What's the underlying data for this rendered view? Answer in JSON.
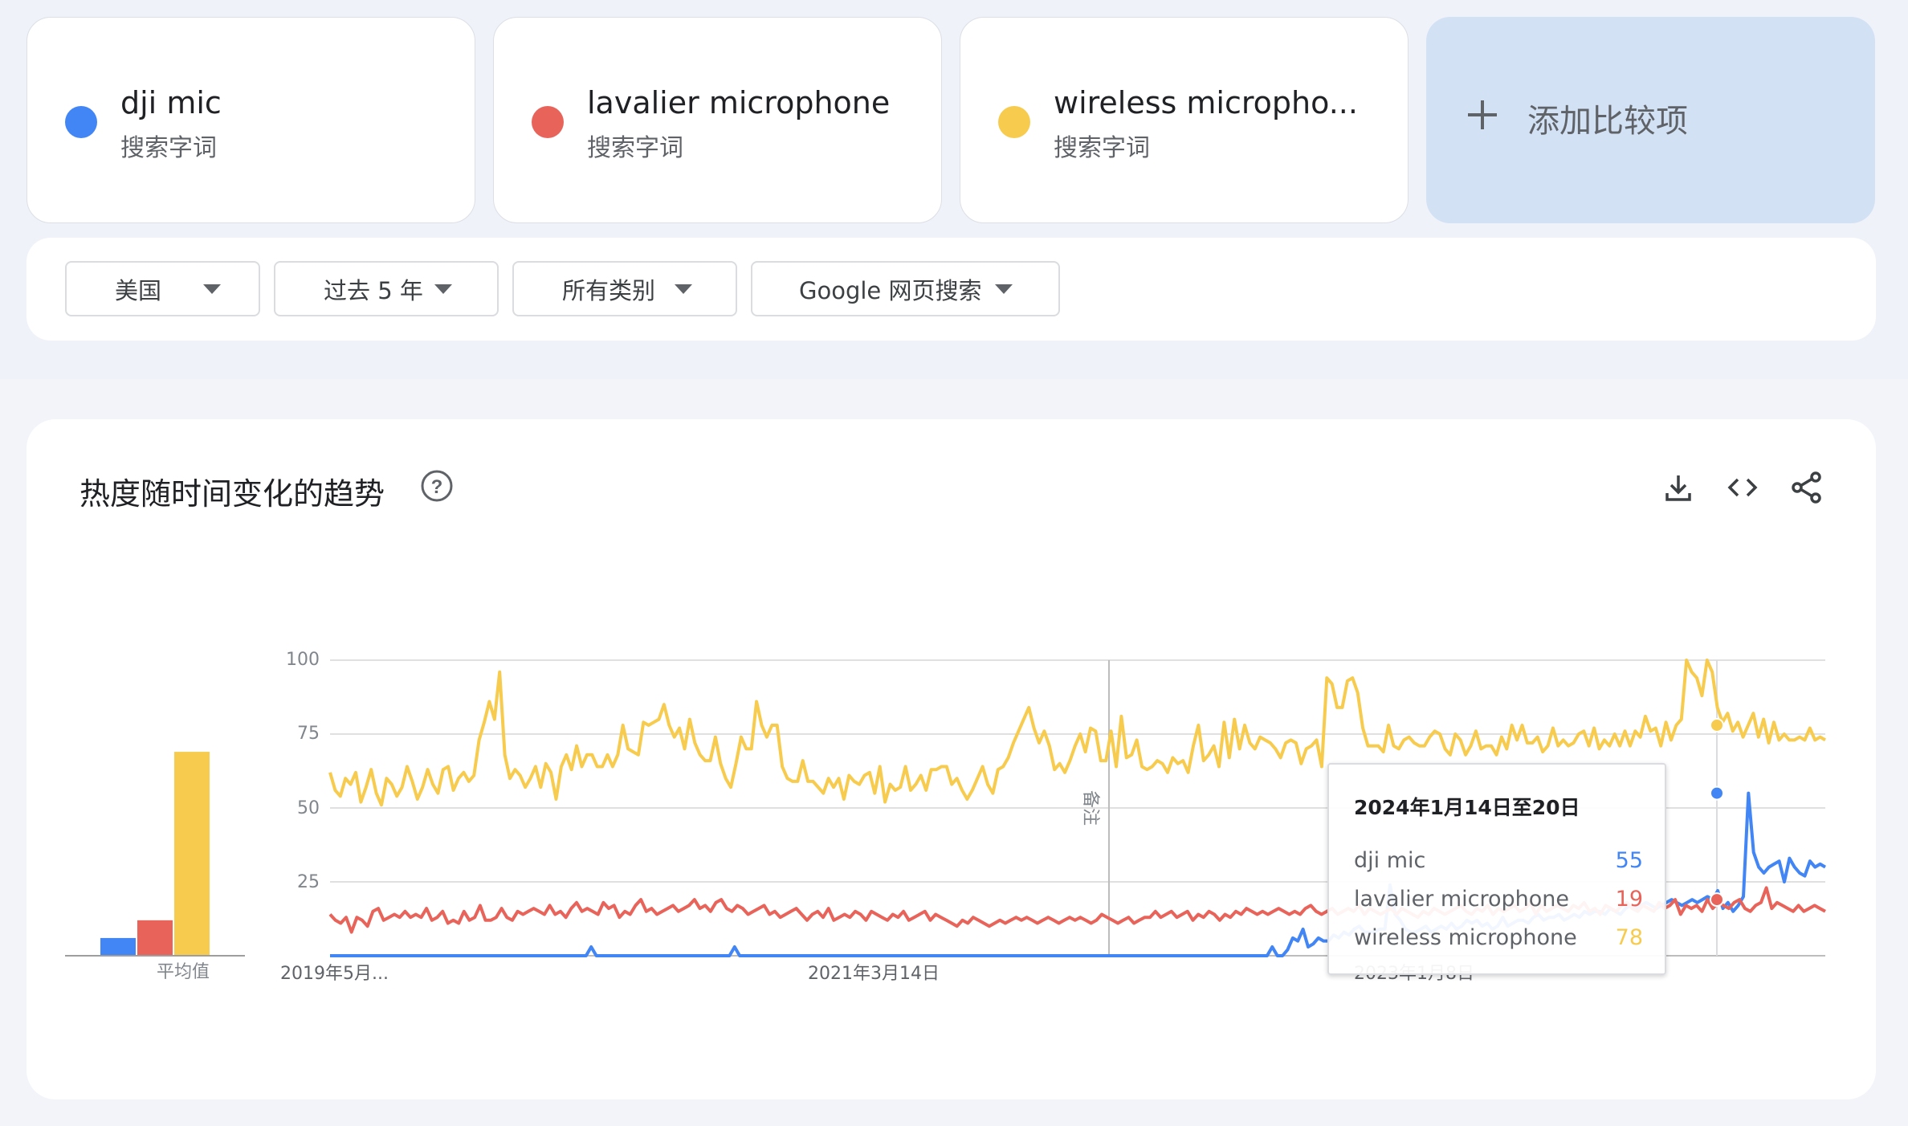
{
  "terms": [
    {
      "name": "dji mic",
      "type": "搜索字词",
      "color": "#4285f4"
    },
    {
      "name": "lavalier microphone",
      "type": "搜索字词",
      "color": "#e8645a"
    },
    {
      "name": "wireless micropho...",
      "type": "搜索字词",
      "color": "#f7cb4d"
    }
  ],
  "add_compare_label": "添加比较项",
  "filters": {
    "region": "美国",
    "time_range": "过去 5 年",
    "category": "所有类别",
    "search_type": "Google 网页搜索"
  },
  "panel": {
    "title": "热度随时间变化的趋势",
    "icons": [
      "help-icon",
      "download-icon",
      "embed-icon",
      "share-icon"
    ],
    "avg_label": "平均值",
    "note_label": "备注"
  },
  "tooltip": {
    "date": "2024年1月14日至20日",
    "rows": [
      {
        "term": "dji mic",
        "value": "55",
        "color": "#4285f4"
      },
      {
        "term": "lavalier microphone",
        "value": "19",
        "color": "#e8645a"
      },
      {
        "term": "wireless microphone",
        "value": "78",
        "color": "#f7cb4d"
      }
    ]
  },
  "chart_data": {
    "type": "line",
    "x_labels": [
      "2019年5月...",
      "2021年3月14日",
      "2023年1月8日"
    ],
    "y_ticks": [
      25,
      50,
      75,
      100
    ],
    "ylim": [
      0,
      100
    ],
    "grid": true,
    "series": [
      {
        "name": "dji mic",
        "color": "#4285f4",
        "average": 6,
        "values": [
          0,
          0,
          0,
          0,
          0,
          0,
          0,
          0,
          0,
          0,
          0,
          0,
          0,
          0,
          0,
          0,
          0,
          0,
          0,
          0,
          0,
          0,
          0,
          0,
          0,
          0,
          0,
          0,
          0,
          0,
          0,
          0,
          0,
          0,
          0,
          0,
          0,
          0,
          0,
          0,
          0,
          0,
          0,
          0,
          0,
          0,
          0,
          0,
          0,
          0,
          0,
          3,
          0,
          0,
          0,
          0,
          0,
          0,
          0,
          0,
          0,
          0,
          0,
          0,
          0,
          0,
          0,
          0,
          0,
          0,
          0,
          0,
          0,
          0,
          0,
          0,
          0,
          0,
          0,
          3,
          0,
          0,
          0,
          0,
          0,
          0,
          0,
          0,
          0,
          0,
          0,
          0,
          0,
          0,
          0,
          0,
          0,
          0,
          0,
          0,
          0,
          0,
          0,
          0,
          0,
          0,
          0,
          0,
          0,
          0,
          0,
          0,
          0,
          0,
          0,
          0,
          0,
          0,
          0,
          0,
          0,
          0,
          0,
          0,
          0,
          0,
          0,
          0,
          0,
          0,
          0,
          0,
          0,
          0,
          0,
          0,
          0,
          0,
          0,
          0,
          0,
          0,
          0,
          0,
          0,
          0,
          0,
          0,
          0,
          0,
          0,
          0,
          0,
          0,
          0,
          0,
          0,
          0,
          0,
          0,
          0,
          0,
          0,
          0,
          0,
          0,
          0,
          0,
          0,
          0,
          0,
          0,
          0,
          0,
          0,
          0,
          0,
          0,
          0,
          0,
          0,
          0,
          0,
          0,
          3,
          0,
          0,
          2,
          6,
          5,
          9,
          3,
          4,
          6,
          5,
          5,
          7,
          6,
          8,
          7,
          9,
          10,
          8,
          8,
          8,
          9,
          9,
          24,
          14,
          12,
          9,
          8,
          8,
          9,
          10,
          8,
          9,
          10,
          9,
          11,
          9,
          10,
          12,
          11,
          12,
          10,
          11,
          9,
          10,
          13,
          10,
          11,
          12,
          12,
          11,
          13,
          14,
          12,
          13,
          13,
          14,
          12,
          13,
          14,
          13,
          15,
          14,
          15,
          15,
          14,
          16,
          15,
          14,
          16,
          17,
          16,
          17,
          18,
          17,
          16,
          17,
          18,
          19,
          18,
          17,
          18,
          19,
          18,
          19,
          20,
          19,
          22,
          16,
          18,
          15,
          17,
          20,
          55,
          35,
          30,
          28,
          30,
          31,
          32,
          25,
          33,
          30,
          28,
          27,
          32,
          30,
          31,
          30
        ]
      },
      {
        "name": "lavalier microphone",
        "color": "#e8645a",
        "average": 12,
        "values": [
          14,
          12,
          11,
          13,
          8,
          13,
          12,
          10,
          15,
          16,
          12,
          13,
          14,
          13,
          15,
          13,
          14,
          13,
          16,
          12,
          13,
          15,
          11,
          12,
          11,
          15,
          12,
          13,
          17,
          12,
          12,
          13,
          16,
          13,
          12,
          15,
          14,
          15,
          16,
          15,
          14,
          17,
          14,
          15,
          13,
          16,
          18,
          15,
          16,
          15,
          14,
          18,
          16,
          17,
          13,
          15,
          14,
          17,
          19,
          15,
          16,
          14,
          15,
          16,
          17,
          15,
          16,
          17,
          19,
          16,
          17,
          15,
          18,
          19,
          16,
          15,
          17,
          16,
          14,
          15,
          16,
          17,
          14,
          15,
          13,
          14,
          15,
          16,
          14,
          12,
          14,
          15,
          13,
          16,
          12,
          13,
          14,
          13,
          15,
          14,
          12,
          15,
          14,
          13,
          12,
          14,
          13,
          15,
          12,
          13,
          14,
          15,
          12,
          14,
          13,
          12,
          11,
          10,
          12,
          11,
          13,
          12,
          11,
          10,
          11,
          12,
          11,
          12,
          13,
          12,
          13,
          12,
          11,
          12,
          13,
          12,
          11,
          12,
          13,
          12,
          13,
          12,
          11,
          12,
          14,
          13,
          12,
          11,
          12,
          13,
          11,
          12,
          13,
          13,
          15,
          13,
          14,
          15,
          13,
          14,
          15,
          12,
          14,
          13,
          15,
          14,
          12,
          14,
          13,
          15,
          14,
          16,
          15,
          14,
          15,
          14,
          15,
          16,
          15,
          14,
          15,
          14,
          16,
          17,
          15,
          14,
          15,
          16,
          14,
          15,
          16,
          15,
          17,
          14,
          16,
          15,
          14,
          15,
          16,
          14,
          16,
          15,
          14,
          13,
          15,
          14,
          16,
          15,
          14,
          15,
          16,
          17,
          15,
          14,
          16,
          15,
          17,
          14,
          16,
          15,
          16,
          17,
          15,
          16,
          18,
          14,
          17,
          15,
          16,
          17,
          16,
          15,
          17,
          16,
          18,
          15,
          16,
          14,
          17,
          16,
          15,
          17,
          18,
          16,
          15,
          17,
          16,
          15,
          18,
          16,
          17,
          19,
          14,
          17,
          16,
          17,
          15,
          19,
          16,
          18,
          17,
          16,
          18,
          19,
          16,
          15,
          17,
          18,
          23,
          16,
          18,
          17,
          16,
          15,
          17,
          15,
          16,
          17,
          16,
          15
        ]
      },
      {
        "name": "wireless microphone",
        "color": "#f7cb4d",
        "average": 69,
        "values": [
          62,
          56,
          54,
          60,
          58,
          62,
          52,
          57,
          63,
          55,
          51,
          60,
          58,
          54,
          57,
          64,
          59,
          53,
          57,
          63,
          58,
          55,
          63,
          64,
          56,
          60,
          62,
          59,
          61,
          73,
          79,
          86,
          80,
          96,
          68,
          60,
          63,
          61,
          57,
          60,
          64,
          57,
          65,
          62,
          53,
          64,
          68,
          63,
          71,
          64,
          68,
          68,
          64,
          64,
          68,
          64,
          68,
          78,
          70,
          69,
          68,
          79,
          78,
          79,
          80,
          85,
          78,
          74,
          77,
          70,
          80,
          72,
          68,
          66,
          66,
          74,
          65,
          60,
          57,
          65,
          74,
          70,
          70,
          86,
          78,
          74,
          78,
          78,
          64,
          60,
          59,
          59,
          66,
          59,
          59,
          57,
          55,
          60,
          57,
          60,
          53,
          61,
          59,
          58,
          61,
          62,
          55,
          64,
          52,
          58,
          56,
          57,
          64,
          56,
          58,
          61,
          56,
          63,
          63,
          64,
          64,
          58,
          60,
          56,
          53,
          56,
          60,
          64,
          58,
          55,
          63,
          64,
          67,
          72,
          76,
          80,
          84,
          77,
          72,
          76,
          71,
          63,
          65,
          62,
          66,
          71,
          75,
          69,
          77,
          76,
          66,
          66,
          76,
          64,
          81,
          67,
          68,
          73,
          64,
          63,
          64,
          66,
          65,
          62,
          67,
          65,
          66,
          62,
          71,
          78,
          66,
          68,
          71,
          64,
          79,
          67,
          80,
          70,
          78,
          72,
          70,
          74,
          73,
          72,
          70,
          67,
          72,
          73,
          72,
          65,
          70,
          71,
          73,
          64,
          94,
          92,
          84,
          84,
          93,
          94,
          89,
          77,
          71,
          71,
          71,
          69,
          78,
          71,
          70,
          73,
          74,
          72,
          71,
          71,
          74,
          76,
          75,
          70,
          68,
          75,
          73,
          68,
          71,
          76,
          70,
          71,
          71,
          68,
          74,
          70,
          78,
          73,
          78,
          72,
          72,
          74,
          69,
          71,
          77,
          71,
          73,
          71,
          72,
          75,
          76,
          71,
          77,
          70,
          73,
          71,
          75,
          71,
          76,
          71,
          76,
          74,
          81,
          76,
          77,
          71,
          79,
          73,
          78,
          80,
          100,
          96,
          94,
          88,
          100,
          96,
          84,
          79,
          82,
          76,
          79,
          74,
          78,
          82,
          74,
          80,
          72,
          79,
          73,
          75,
          73,
          73,
          74,
          73,
          77,
          73,
          74,
          73
        ]
      }
    ]
  }
}
